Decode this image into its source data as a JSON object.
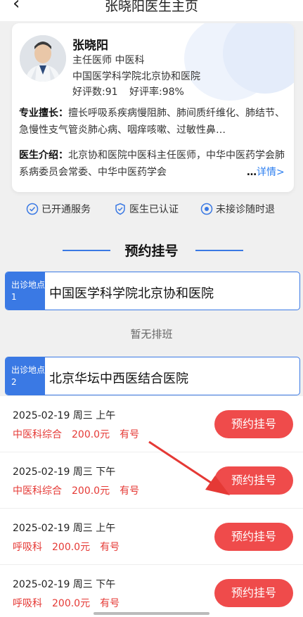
{
  "nav": {
    "back_icon": "chevron-left-icon",
    "title": "张晓阳医生主页"
  },
  "doctor": {
    "name": "张晓阳",
    "title": "主任医师  中医科",
    "hospital": "中国医学科学院北京协和医院",
    "reviews": "好评数:91",
    "rating": "好评率:98%",
    "specialty_label": "专业擅长：",
    "specialty": "擅长呼吸系疾病慢阻肺、肺间质纤维化、肺结节、急慢性支气管炎肺心病、咽痒咳嗽、过敏性鼻…",
    "intro_label": "医生介绍：",
    "intro": "北京协和医院中医科主任医师，中华中医药学会肺系病委员会常委、中华中医药学会",
    "more_dots": "…",
    "more_link": "详情>"
  },
  "badges": [
    {
      "icon": "check-circle-icon",
      "label": "已开通服务"
    },
    {
      "icon": "shield-check-icon",
      "label": "医生已认证"
    },
    {
      "icon": "refund-icon",
      "label": "未接诊随时退"
    }
  ],
  "section_title": "预约挂号",
  "locations": [
    {
      "tag": "出诊地点1",
      "name": "中国医学科学院北京协和医院"
    },
    {
      "tag": "出诊地点2",
      "name": "北京华坛中西医结合医院"
    }
  ],
  "empty_text": "暂无排班",
  "slots": [
    {
      "date": "2025-02-19 周三 上午",
      "dept": "中医科综合",
      "price": "200.0元",
      "status": "有号",
      "button": "预约挂号"
    },
    {
      "date": "2025-02-19 周三 下午",
      "dept": "中医科综合",
      "price": "200.0元",
      "status": "有号",
      "button": "预约挂号"
    },
    {
      "date": "2025-02-19 周三 上午",
      "dept": "呼吸科",
      "price": "200.0元",
      "status": "有号",
      "button": "预约挂号"
    },
    {
      "date": "2025-02-19 周三 下午",
      "dept": "呼吸科",
      "price": "200.0元",
      "status": "有号",
      "button": "预约挂号"
    }
  ],
  "colors": {
    "accent": "#3a79e4",
    "book_button": "#ef4b4b",
    "price_text": "#e53935",
    "annotation_arrow": "#e53935"
  }
}
